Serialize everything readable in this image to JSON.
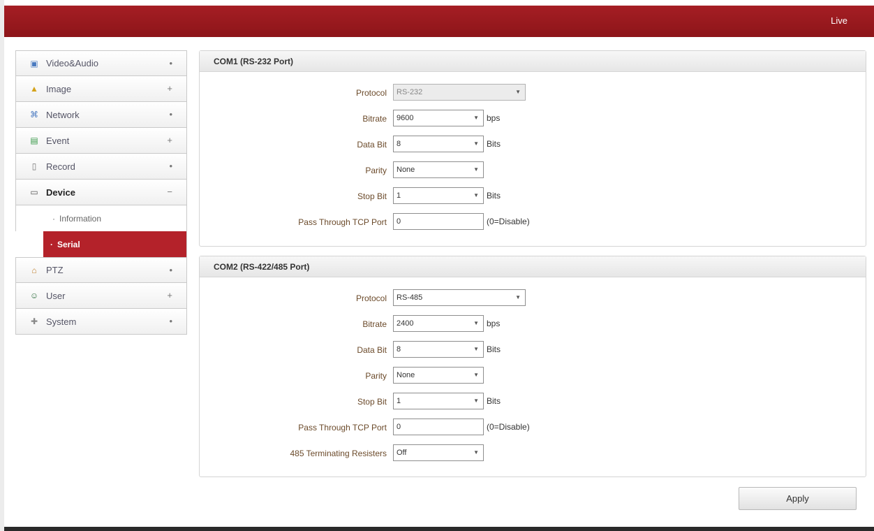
{
  "header": {
    "live_label": "Live"
  },
  "sidebar": {
    "items": [
      {
        "label": "Video&Audio",
        "icon": "video-audio-icon",
        "glyph": "▣",
        "sign": "•"
      },
      {
        "label": "Image",
        "icon": "image-icon",
        "glyph": "▲",
        "sign": "+"
      },
      {
        "label": "Network",
        "icon": "network-icon",
        "glyph": "⌘",
        "sign": "•"
      },
      {
        "label": "Event",
        "icon": "event-icon",
        "glyph": "▤",
        "sign": "+"
      },
      {
        "label": "Record",
        "icon": "record-icon",
        "glyph": "▯",
        "sign": "•"
      },
      {
        "label": "Device",
        "icon": "device-icon",
        "glyph": "▭",
        "sign": "−"
      },
      {
        "label": "PTZ",
        "icon": "ptz-icon",
        "glyph": "⌂",
        "sign": "•"
      },
      {
        "label": "User",
        "icon": "user-icon",
        "glyph": "☺",
        "sign": "+"
      },
      {
        "label": "System",
        "icon": "system-icon",
        "glyph": "✚",
        "sign": "•"
      }
    ],
    "device_sub": [
      {
        "label": "Information"
      },
      {
        "label": "Serial"
      }
    ]
  },
  "com1": {
    "title": "COM1 (RS-232 Port)",
    "protocol_label": "Protocol",
    "protocol_value": "RS-232",
    "bitrate_label": "Bitrate",
    "bitrate_value": "9600",
    "bitrate_unit": "bps",
    "databit_label": "Data Bit",
    "databit_value": "8",
    "databit_unit": "Bits",
    "parity_label": "Parity",
    "parity_value": "None",
    "stopbit_label": "Stop Bit",
    "stopbit_value": "1",
    "stopbit_unit": "Bits",
    "tcp_label": "Pass Through TCP Port",
    "tcp_value": "0",
    "tcp_note": "(0=Disable)"
  },
  "com2": {
    "title": "COM2 (RS-422/485 Port)",
    "protocol_label": "Protocol",
    "protocol_value": "RS-485",
    "bitrate_label": "Bitrate",
    "bitrate_value": "2400",
    "bitrate_unit": "bps",
    "databit_label": "Data Bit",
    "databit_value": "8",
    "databit_unit": "Bits",
    "parity_label": "Parity",
    "parity_value": "None",
    "stopbit_label": "Stop Bit",
    "stopbit_value": "1",
    "stopbit_unit": "Bits",
    "tcp_label": "Pass Through TCP Port",
    "tcp_value": "0",
    "tcp_note": "(0=Disable)",
    "term_label": "485 Terminating Resisters",
    "term_value": "Off"
  },
  "apply_label": "Apply",
  "colors": {
    "brand_red": "#a51e24",
    "selected_red": "#b4222a"
  }
}
